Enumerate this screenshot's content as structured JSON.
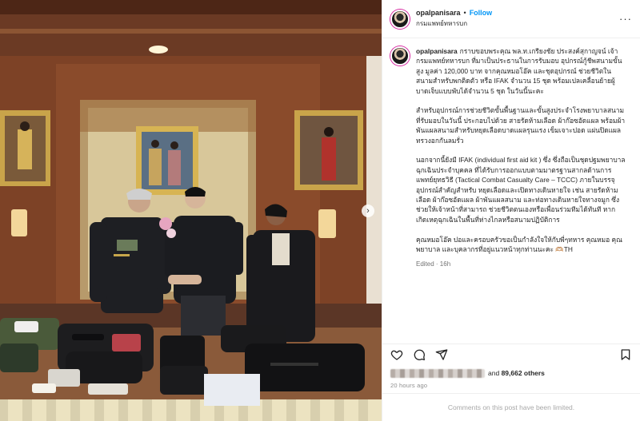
{
  "post": {
    "username": "opalpanisara",
    "follow_label": "Follow",
    "separator": "•",
    "location": "กรมแพทย์ทหารบก",
    "more_label": "···"
  },
  "caption": {
    "username": "opalpanisara",
    "paragraphs": [
      "กราบขอบพระคุณ พล.ท.เกรียงชัย ประสงค์สุกาญจน์ เจ้ากรมแพทย์ทหารบก ที่มาเป็นประธานในการรับมอบ อุปกรณ์กู้ชีพสนามขั้นสูง มูลค่า 120,000 บาท จากคุณหมอโอ๊ค และชุดอุปกรณ์ ช่วยชีวิตในสนามสำหรับพกติดตัว หรือ IFAK จำนวน 15 ชุด พร้อมเปลเคลื่อนย้ายผู้บาดเจ็บแบบพับได้จำนวน 5 ชุด ในวันนี้นะคะ",
      "สำหรับอุปกรณ์การช่วยชีวิตขั้นพื้นฐานและขั้นสูงประจำโรงพยาบาลสนาม ที่รับมอบในวันนี้ ประกอบไปด้วย สายรัดห้ามเลือด ผ้าก๊อซอัดแผล พร้อมผ้าพันแผลสนามสำหรับหยุดเลือดบาดแผลรุนแรง เข็มเจาะปอด แผ่นปิดแผลทรวงอกกันลมรั่ว",
      "นอกจากนี้ยังมี IFAK (individual first aid kit ) ซึ่ง ซึ่งถือเป็นชุดปฐมพยาบาลฉุกเฉินประจำบุคคล ที่ได้รับการออกแบบตามมาตรฐานสากลด้านการแพทย์ยุทธวิธี (Tactical Combat Casualty Care – TCCC) ภายในบรรจุอุปกรณ์สำคัญสำหรับ หยุดเลือดและเปิดทางเดินหายใจ เช่น สายรัดห้ามเลือด ผ้าก๊อซอัดแผล ผ้าพันแผลสนาม และท่อทางเดินหายใจทางจมูก ซึ่งช่วยให้เจ้าหน้าที่สามารถ ช่วยชีวิตตนเองหรือเพื่อนร่วมทีมได้ทันที หากเกิดเหตุฉุกเฉินในพื้นที่ห่างไกลหรือสนามปฏิบัติการ",
      "คุณหมอโอ๊ค ปอและครอบครัวขอเป็นกำลังใจให้กับพี่ๆทหาร คุณหมอ คุณพยาบาล และบุคลากรที่อยู่แนวหน้าทุกท่านนะคะ 🫶🏼TH"
    ],
    "edited": "Edited · 16h"
  },
  "likes": {
    "text_prefix": "and",
    "count": "89,662 others"
  },
  "time_ago": "20 hours ago",
  "comments_notice": "Comments on this post have been limited.",
  "icons": {
    "like": "heart-icon",
    "comment": "comment-icon",
    "share": "send-icon",
    "save": "bookmark-icon",
    "next": "chevron-right-icon"
  },
  "colors": {
    "follow": "#0095f6",
    "text": "#262626",
    "muted": "#737373"
  }
}
